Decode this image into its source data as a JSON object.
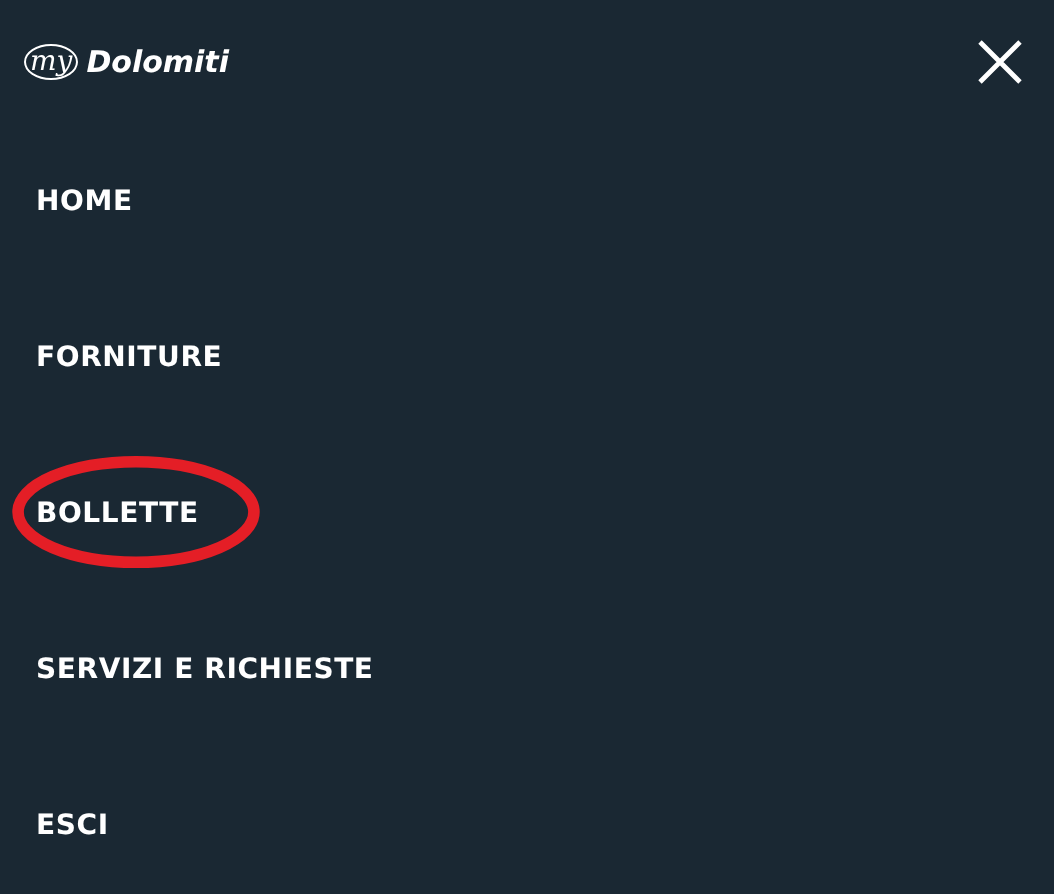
{
  "header": {
    "logo_script": "my",
    "logo_name": "Dolomiti"
  },
  "menu": [
    {
      "label": "HOME",
      "circled": false
    },
    {
      "label": "FORNITURE",
      "circled": false
    },
    {
      "label": "BOLLETTE",
      "circled": true
    },
    {
      "label": "SERVIZI E RICHIESTE",
      "circled": false
    },
    {
      "label": "ESCI",
      "circled": false
    }
  ]
}
